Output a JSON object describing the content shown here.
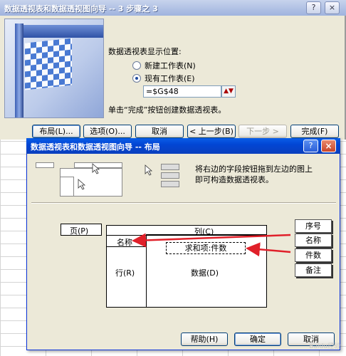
{
  "wizard": {
    "title": "数据透视表和数据透视图向导 -- 3 步骤之 3",
    "help_btn": "?",
    "close_btn": "×",
    "heading": "数据透视表显示位置:",
    "option_new": "新建工作表(N)",
    "option_existing": "现有工作表(E)",
    "location_value": "=$G$48",
    "note": "单击“完成”按钮创建数据透视表。",
    "buttons": {
      "layout": "布局(L)...",
      "options": "选项(O)...",
      "cancel": "取消",
      "back": "< 上一步(B)",
      "next": "下一步 >",
      "finish": "完成(F)"
    }
  },
  "layout_dialog": {
    "title": "数据透视表和数据透视图向导 -- 布局",
    "help_btn": "?",
    "close_btn": "×",
    "instruction_line1": "将右边的字段按钮拖到左边的图上",
    "instruction_line2": "即可构造数据透视表。",
    "areas": {
      "page": "页(P)",
      "column": "列(C)",
      "row": "行(R)",
      "data": "数据(D)"
    },
    "placed_fields": {
      "row": "名称",
      "data": "求和项:件数"
    },
    "field_list": [
      "序号",
      "名称",
      "件数",
      "备注"
    ],
    "buttons": {
      "help": "帮助(H)",
      "ok": "确定",
      "cancel": "取消"
    }
  },
  "watermark": "Baidu经验",
  "colors": {
    "arrow": "#e0202a",
    "title_active": "#0a5ee8",
    "title_inactive": "#9fb3de",
    "dialog_bg": "#ece9d8"
  }
}
